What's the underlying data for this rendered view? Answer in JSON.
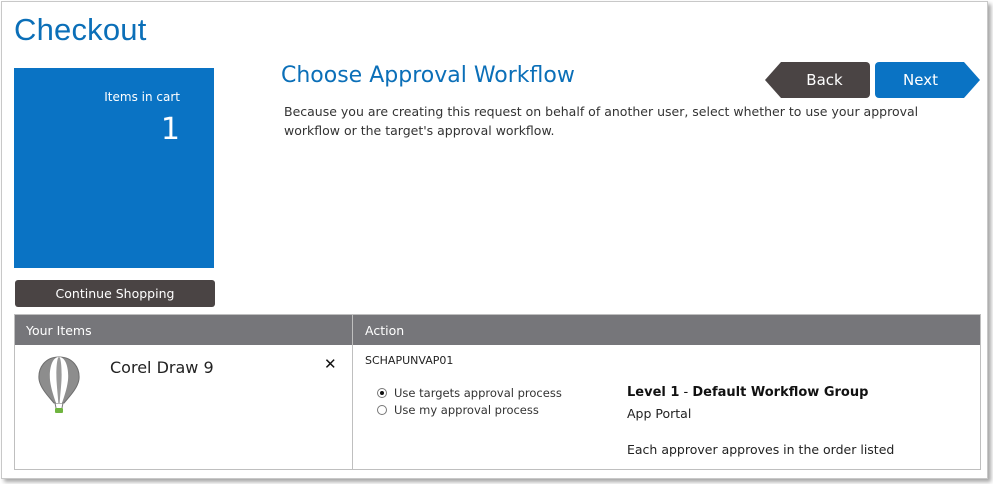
{
  "page": {
    "title": "Checkout"
  },
  "cart": {
    "label": "Items in cart",
    "count": "1",
    "continue_label": "Continue Shopping"
  },
  "section": {
    "title": "Choose Approval Workflow",
    "description": "Because you are creating this request on behalf of another user, select whether to use your approval workflow or the target's approval workflow."
  },
  "nav": {
    "back_label": "Back",
    "next_label": "Next"
  },
  "grid": {
    "headers": {
      "items": "Your Items",
      "action": "Action"
    },
    "item": {
      "name": "Corel Draw 9",
      "remove_symbol": "✕",
      "icon": "hot-air-balloon-icon"
    },
    "action": {
      "user_id": "SCHAPUNVAP01",
      "options": [
        {
          "label": "Use targets approval process",
          "selected": true
        },
        {
          "label": "Use my approval process",
          "selected": false
        }
      ],
      "workflow": {
        "level_label": "Level 1",
        "separator": " - ",
        "group_name": "Default Workflow Group",
        "portal": "App Portal",
        "note": "Each approver approves in the order listed"
      }
    }
  },
  "colors": {
    "brand_blue": "#0a73c4",
    "title_blue": "#0b6fb8",
    "dark_button": "#4a4444",
    "header_gray": "#76767a",
    "balloon_accent": "#6fb43f"
  }
}
